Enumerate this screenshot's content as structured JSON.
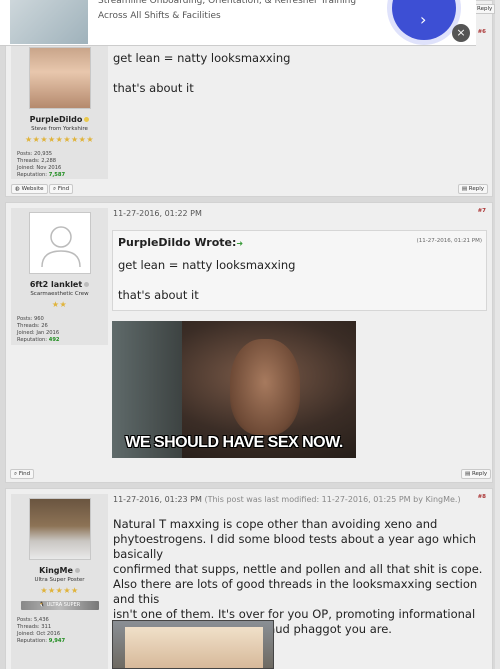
{
  "ad": {
    "line1": "Streamline Onboarding, Orientation, & Refresher Training",
    "line2": "Across All Shifts & Facilities",
    "close_glyph": "×",
    "go_glyph": "›"
  },
  "posts": [
    {
      "number": "#6",
      "username": "PurpleDildo",
      "user_title": "Steve from Yorkshire",
      "stars": "★★★★★★★★★",
      "stats": {
        "posts": "Posts: 20,935",
        "threads": "Threads: 2,288",
        "joined": "Joined: Nov 2016",
        "reputation_label": "Reputation:",
        "reputation_value": "7,587"
      },
      "text_line1": "get lean = natty looksmaxxing",
      "text_line2": "that's about it",
      "btn_website": "Website",
      "btn_find": "Find",
      "btn_reply": "Reply"
    },
    {
      "number": "#7",
      "username": "6ft2 lanklet",
      "user_title": "Scarmaesthetic Crew",
      "stars": "★★",
      "stats": {
        "posts": "Posts: 960",
        "threads": "Threads: 26",
        "joined": "Joined: Jan 2016",
        "reputation_label": "Reputation:",
        "reputation_value": "492"
      },
      "date": "11-27-2016, 01:22 PM",
      "quote_author": "PurpleDildo Wrote:",
      "quote_date": "(11-27-2016, 01:21 PM)",
      "quote_line1": "get lean = natty looksmaxxing",
      "quote_line2": "that's about it",
      "image_caption": "WE SHOULD HAVE SEX NOW.",
      "btn_find": "Find",
      "btn_reply": "Reply"
    },
    {
      "number": "#8",
      "username": "KingMe",
      "user_title": "Ultra Super Poster",
      "stars": "★★★★★",
      "rank_text": "ULTRA SUPER",
      "stats": {
        "posts": "Posts: 5,436",
        "threads": "Threads: 311",
        "joined": "Joined: Oct 2016",
        "reputation_label": "Reputation:",
        "reputation_value": "9,947"
      },
      "date": "11-27-2016, 01:23 PM",
      "modified": "(This post was last modified: 11-27-2016, 01:25 PM by KingMe.)",
      "body": [
        "Natural T maxxing is cope other than avoiding xeno and",
        "phytoestrogens. I did some blood tests about a year ago which basically",
        "confirmed that supps, nettle and pollen and all that shit is cope.",
        "Also there are lots of good threads in the looksmaxxing section and this",
        "isn't one of them. It's over for you OP, promoting informational",
        "products and shit what a fraud phaggot you are."
      ]
    }
  ]
}
